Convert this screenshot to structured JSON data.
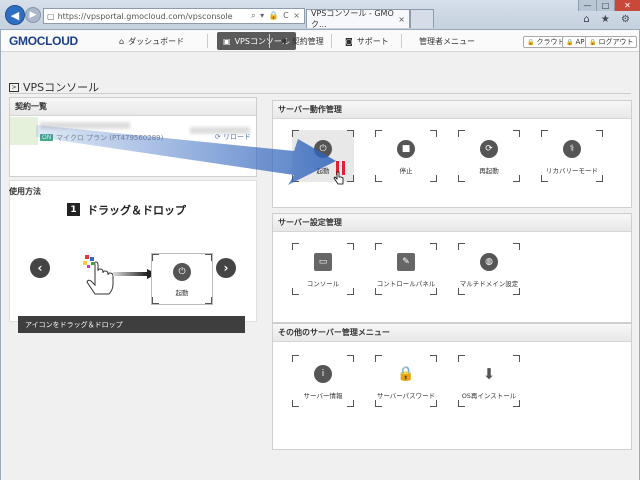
{
  "browser": {
    "address": "https://vpsportal.gmocloud.com/vpsconsole",
    "address_tools": "⌕ ▾ 🔒 C ×",
    "tab_active": "VPSコンソール - GMOク...",
    "tab_close": "×",
    "window_controls": [
      "—",
      "□",
      "✕"
    ],
    "chrome_icons": "⌂ ★ ⚙"
  },
  "site": {
    "logo": "GMOCLOUD",
    "nav": [
      {
        "label": "ダッシュボード",
        "icon": "home-icon",
        "glyph": "⌂"
      },
      {
        "label": "VPSコンソール",
        "icon": "monitor-icon",
        "glyph": "▣"
      },
      {
        "label": "契約管理",
        "icon": "gear-icon",
        "glyph": "✱"
      },
      {
        "label": "サポート",
        "icon": "camera-icon",
        "glyph": "◙"
      },
      {
        "label": "管理者メニュー",
        "icon": "",
        "glyph": ""
      }
    ],
    "right_buttons": [
      {
        "label": "クラウド",
        "icon": "lock-icon"
      },
      {
        "label": "API",
        "icon": "lock-icon"
      },
      {
        "label": "ログアウト",
        "icon": "lock-icon"
      }
    ]
  },
  "page": {
    "title": "VPSコンソール"
  },
  "contracts": {
    "header": "契約一覧",
    "badge": "ON",
    "plan": "マイクロ プラン (PT479560289)",
    "reload": "リロード"
  },
  "howto": {
    "title": "使用方法",
    "step_number": "1",
    "step_text": "ドラッグ＆ドロップ",
    "demo_label": "起動",
    "instruction": "アイコンをドラッグ＆ドロップ",
    "prev": "‹",
    "next": "›"
  },
  "server_ops": {
    "header": "サーバー動作管理",
    "items": [
      {
        "label": "起動",
        "icon": "power-icon",
        "glyph": "⏻"
      },
      {
        "label": "停止",
        "icon": "stop-icon",
        "glyph": "■"
      },
      {
        "label": "再起動",
        "icon": "restart-icon",
        "glyph": "⟳"
      },
      {
        "label": "リカバリーモード",
        "icon": "recovery-icon",
        "glyph": "⚕"
      }
    ]
  },
  "server_settings": {
    "header": "サーバー設定管理",
    "items": [
      {
        "label": "コンソール",
        "icon": "console-icon",
        "glyph": "▭"
      },
      {
        "label": "コントロールパネル",
        "icon": "wrench-icon",
        "glyph": "✎"
      },
      {
        "label": "マルチドメイン設定",
        "icon": "globe-icon",
        "glyph": "◍"
      }
    ]
  },
  "other_menu": {
    "header": "その他のサーバー管理メニュー",
    "items": [
      {
        "label": "サーバー情報",
        "icon": "info-icon",
        "glyph": "i"
      },
      {
        "label": "サーバーパスワード",
        "icon": "padlock-icon",
        "glyph": "🔒"
      },
      {
        "label": "OS再インストール",
        "icon": "download-icon",
        "glyph": "⬇"
      }
    ]
  },
  "colors": {
    "brand": "#1a3f8c",
    "nav_active": "#5a5a5a",
    "pause_red": "#dd2233",
    "drag_arrow": "#3a6fc4"
  }
}
